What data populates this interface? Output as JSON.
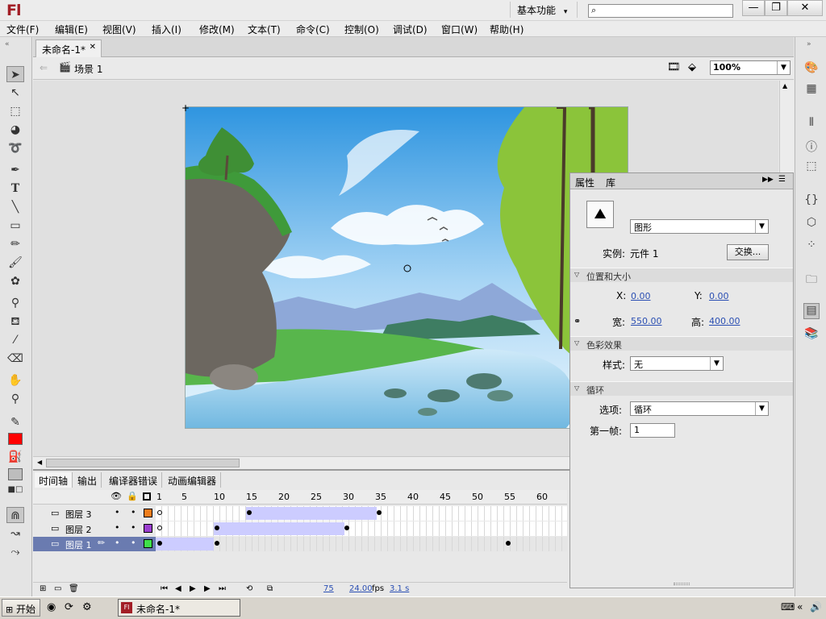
{
  "app": {
    "logo": "Fl",
    "workspace": "基本功能",
    "search_placeholder": ""
  },
  "window_buttons": {
    "minimize": "—",
    "restore": "❐",
    "close": "✕"
  },
  "menu": [
    "文件(F)",
    "编辑(E)",
    "视图(V)",
    "插入(I)",
    "修改(M)",
    "文本(T)",
    "命令(C)",
    "控制(O)",
    "调试(D)",
    "窗口(W)",
    "帮助(H)"
  ],
  "document": {
    "tab_title": "未命名-1*",
    "scene": "场景 1",
    "zoom": "100%"
  },
  "timeline": {
    "tabs": [
      "时间轴",
      "输出",
      "编译器错误",
      "动画编辑器"
    ],
    "ruler": [
      "1",
      "5",
      "10",
      "15",
      "20",
      "25",
      "30",
      "35",
      "40",
      "45",
      "50",
      "55",
      "60"
    ],
    "layers": [
      {
        "name": "图层 3",
        "color": "#f07d1c"
      },
      {
        "name": "图层 2",
        "color": "#9b3fd0"
      },
      {
        "name": "图层 1",
        "color": "#3fe04a"
      }
    ],
    "status": {
      "frame": "75",
      "fps": "24.00",
      "fps_unit": "fps",
      "time": "3.1 s"
    }
  },
  "properties": {
    "tabs": [
      "属性",
      "库"
    ],
    "symbol_type": "图形",
    "instance_label": "实例:",
    "instance_name": "元件 1",
    "swap_button": "交换...",
    "section_position": "位置和大小",
    "x_label": "X:",
    "x_value": "0.00",
    "y_label": "Y:",
    "y_value": "0.00",
    "w_label": "宽:",
    "w_value": "550.00",
    "h_label": "高:",
    "h_value": "400.00",
    "section_color": "色彩效果",
    "style_label": "样式:",
    "style_value": "无",
    "section_loop": "循环",
    "options_label": "选项:",
    "options_value": "循环",
    "first_frame_label": "第一帧:",
    "first_frame_value": "1"
  },
  "taskbar": {
    "start": "开始",
    "item": "未命名-1*"
  }
}
